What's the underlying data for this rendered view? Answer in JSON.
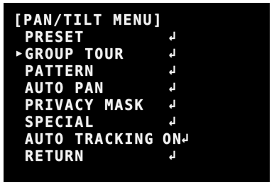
{
  "menu": {
    "title": "[PAN/TILT MENU]",
    "cursor_symbol": "▶",
    "enter_symbol": "↲",
    "items": [
      {
        "label": "PRESET",
        "value": "",
        "selected": false
      },
      {
        "label": "GROUP TOUR",
        "value": "",
        "selected": true
      },
      {
        "label": "PATTERN",
        "value": "",
        "selected": false
      },
      {
        "label": "AUTO PAN",
        "value": "",
        "selected": false
      },
      {
        "label": "PRIVACY MASK",
        "value": "",
        "selected": false
      },
      {
        "label": "SPECIAL",
        "value": "",
        "selected": false
      },
      {
        "label": "AUTO TRACKING",
        "value": "ON",
        "selected": false
      },
      {
        "label": "RETURN",
        "value": "",
        "selected": false
      }
    ]
  },
  "colors": {
    "background": "#000000",
    "text": "#f2f2f2"
  }
}
